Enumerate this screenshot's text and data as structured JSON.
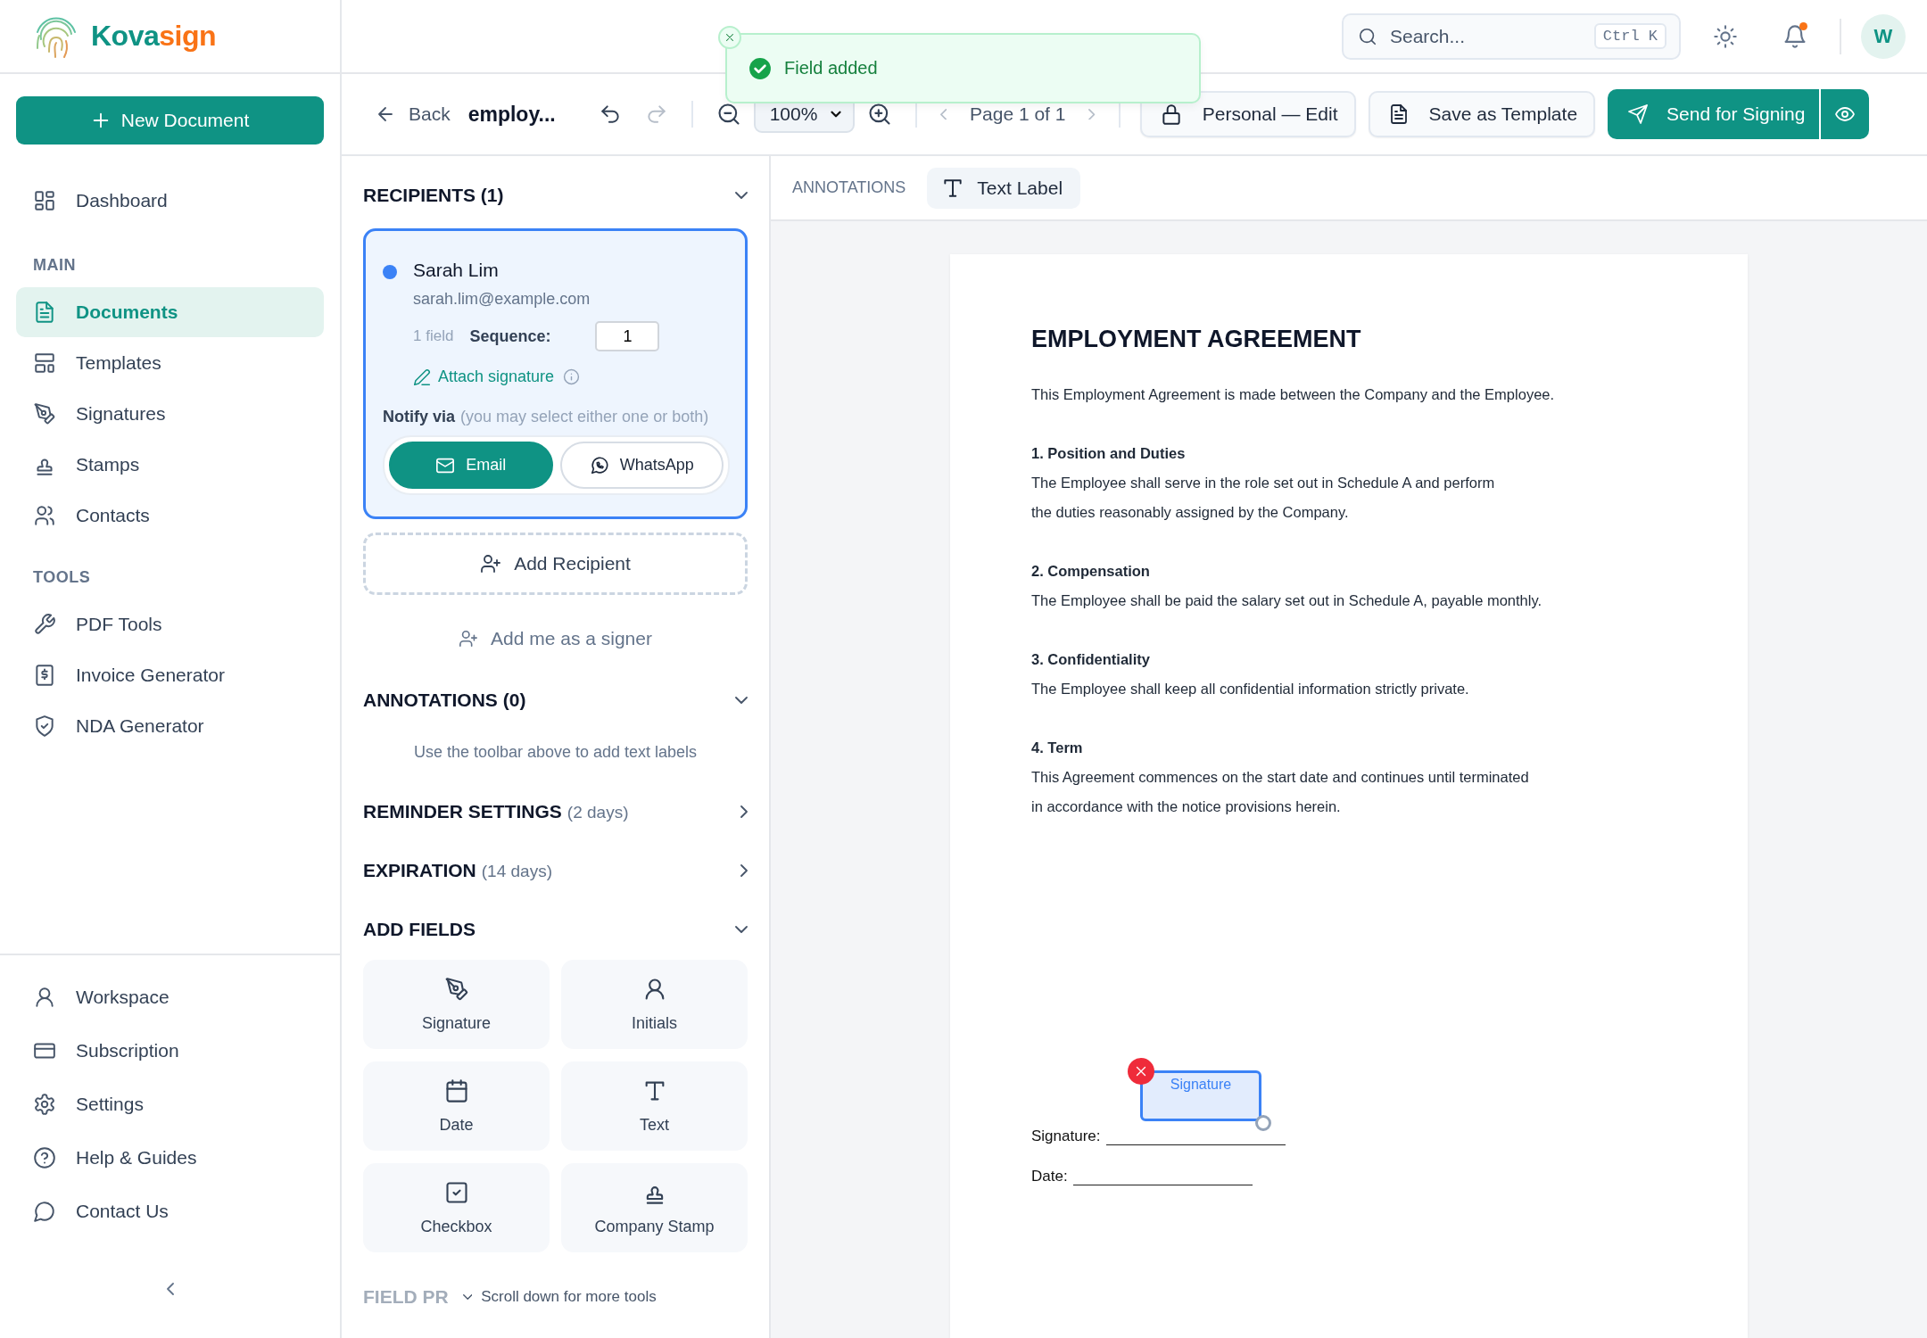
{
  "sidebar": {
    "logo": {
      "first": "Kova",
      "second": "sign"
    },
    "new_button": "New Document",
    "top_items": [
      {
        "label": "Dashboard",
        "selected": false
      }
    ],
    "groups": [
      {
        "heading": "MAIN",
        "items": [
          {
            "label": "Documents",
            "selected": true
          },
          {
            "label": "Templates",
            "selected": false
          },
          {
            "label": "Signatures",
            "selected": false
          },
          {
            "label": "Stamps",
            "selected": false
          },
          {
            "label": "Contacts",
            "selected": false
          }
        ]
      },
      {
        "heading": "TOOLS",
        "items": [
          {
            "label": "PDF Tools",
            "selected": false
          },
          {
            "label": "Invoice Generator",
            "selected": false
          },
          {
            "label": "NDA Generator",
            "selected": false
          }
        ]
      }
    ],
    "bottom_items": [
      {
        "label": "Workspace",
        "selected": false
      },
      {
        "label": "Subscription",
        "selected": false
      },
      {
        "label": "Settings",
        "selected": false
      },
      {
        "label": "Help & Guides",
        "selected": false
      },
      {
        "label": "Contact Us",
        "selected": false
      }
    ]
  },
  "header": {
    "search": {
      "placeholder": "Search...",
      "shortcut": "Ctrl K"
    },
    "notifications": {
      "unread": true
    },
    "avatar": "W"
  },
  "toast": {
    "message": "Field added"
  },
  "toolbar": {
    "back": "Back",
    "title": "employ...",
    "undo": {
      "disabled": false
    },
    "redo": {
      "disabled": true
    },
    "zoom": "100%",
    "page": {
      "label": "Page 1 of 1",
      "prev_disabled": true,
      "next_disabled": true
    },
    "mode_button": "Personal — Edit",
    "template_button": "Save as Template",
    "send_button": "Send for Signing"
  },
  "panel": {
    "recipients": {
      "title": "RECIPIENTS (1)",
      "expanded": true,
      "items": [
        {
          "name": "Sarah Lim",
          "email": "sarah.lim@example.com",
          "color": "#3b82f6",
          "selected": true,
          "fields": "1 field",
          "sequence_label": "Sequence:",
          "sequence": "1",
          "attach": "Attach signature",
          "notify_label": "Notify via",
          "notify_hint": "(you may select either one or both)",
          "channels": [
            {
              "label": "Email",
              "selected": true
            },
            {
              "label": "WhatsApp",
              "selected": false
            }
          ]
        }
      ],
      "add_recipient": "Add Recipient",
      "add_me": "Add me as a signer"
    },
    "annotations": {
      "title": "ANNOTATIONS (0)",
      "expanded": true,
      "empty": "Use the toolbar above to add text labels"
    },
    "settings": [
      {
        "title": "REMINDER SETTINGS",
        "detail": "(2 days)",
        "expanded": false
      },
      {
        "title": "EXPIRATION",
        "detail": "(14 days)",
        "expanded": false
      }
    ],
    "add_fields": {
      "title": "ADD FIELDS",
      "expanded": true,
      "items": [
        "Signature",
        "Initials",
        "Date",
        "Text",
        "Checkbox",
        "Company Stamp"
      ]
    },
    "field_properties": "FIELD PR",
    "scroll_hint": "Scroll down for more tools"
  },
  "canvas": {
    "toolbar_label": "ANNOTATIONS",
    "tool": "Text Label",
    "document": {
      "title": "EMPLOYMENT AGREEMENT",
      "intro": "This Employment Agreement is made between the Company and the Employee.",
      "sections": [
        {
          "heading": "1. Position and Duties",
          "lines": [
            "The Employee shall serve in the role set out in Schedule A and perform",
            "the duties reasonably assigned by the Company."
          ]
        },
        {
          "heading": "2. Compensation",
          "lines": [
            "The Employee shall be paid the salary set out in Schedule A, payable monthly."
          ]
        },
        {
          "heading": "3. Confidentiality",
          "lines": [
            "The Employee shall keep all confidential information strictly private."
          ]
        },
        {
          "heading": "4. Term",
          "lines": [
            "This Agreement commences on the start date and continues until terminated",
            "in accordance with the notice provisions herein."
          ]
        }
      ],
      "sign_lines": [
        "Signature:",
        "Date:"
      ],
      "placed_fields": [
        {
          "label": "Signature",
          "selected": true
        }
      ]
    }
  }
}
